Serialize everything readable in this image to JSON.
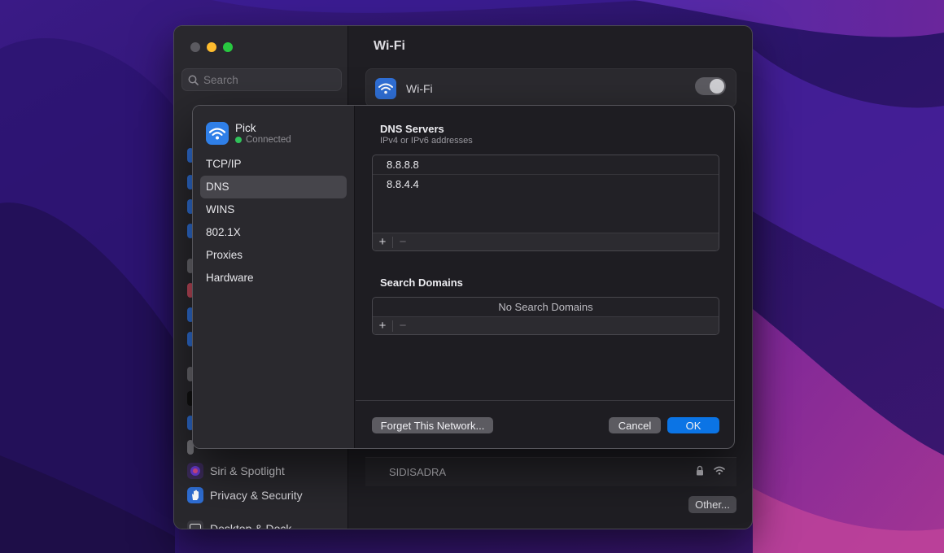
{
  "colors": {
    "accent": "#0b74e5",
    "connected": "#30c25a",
    "wifi_icon": "#2f7fe8"
  },
  "window": {
    "title": "Wi-Fi",
    "search_placeholder": "Search",
    "sidebar_items": [
      {
        "label": "Siri & Spotlight",
        "icon": "siri-icon"
      },
      {
        "label": "Privacy & Security",
        "icon": "hand-icon"
      },
      {
        "label": "Desktop & Dock",
        "icon": "dock-icon"
      }
    ],
    "wifi_row_label": "Wi-Fi",
    "wifi_enabled": true,
    "network_row": {
      "name": "SIDISADRA",
      "locked": true
    },
    "other_button": "Other..."
  },
  "sheet": {
    "network_name": "Pick",
    "network_status": "Connected",
    "nav": [
      {
        "label": "TCP/IP",
        "active": false
      },
      {
        "label": "DNS",
        "active": true
      },
      {
        "label": "WINS",
        "active": false
      },
      {
        "label": "802.1X",
        "active": false
      },
      {
        "label": "Proxies",
        "active": false
      },
      {
        "label": "Hardware",
        "active": false
      }
    ],
    "dns": {
      "title": "DNS Servers",
      "subtitle": "IPv4 or IPv6 addresses",
      "servers": [
        "8.8.8.8",
        "8.8.4.4"
      ]
    },
    "search_domains": {
      "title": "Search Domains",
      "empty_text": "No Search Domains"
    },
    "buttons": {
      "add": "+",
      "remove": "−",
      "forget": "Forget This Network...",
      "cancel": "Cancel",
      "ok": "OK"
    }
  }
}
